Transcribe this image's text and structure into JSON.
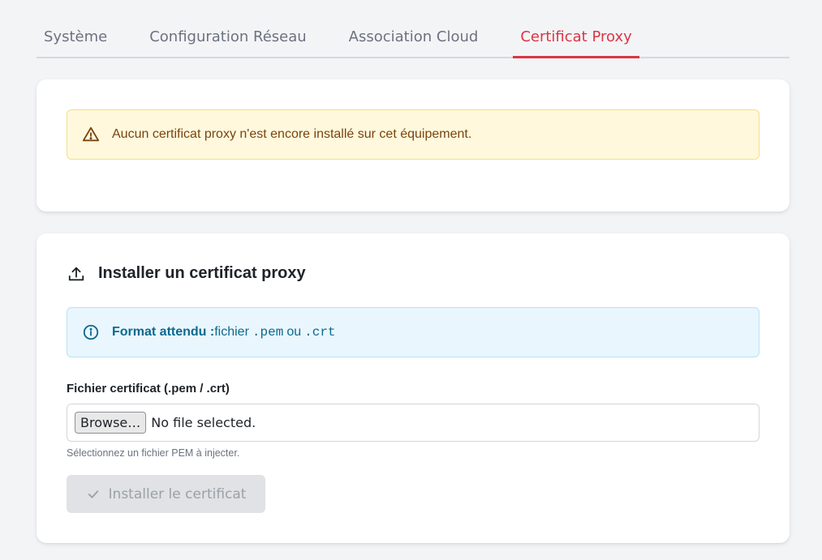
{
  "tabs": [
    {
      "label": "Système",
      "active": false
    },
    {
      "label": "Configuration Réseau",
      "active": false
    },
    {
      "label": "Association Cloud",
      "active": false
    },
    {
      "label": "Certificat Proxy",
      "active": true
    }
  ],
  "status_card": {
    "warning_icon": "warning-triangle-icon",
    "warning_text": "Aucun certificat proxy n'est encore installé sur cet équipement."
  },
  "install_card": {
    "title_icon": "upload-icon",
    "title": "Installer un certificat proxy",
    "info_icon": "info-circle-icon",
    "info_strong": "Format attendu :",
    "info_text_1": "fichier",
    "info_code_1": ".pem",
    "info_text_2": "ou",
    "info_code_2": ".crt",
    "field_label": "Fichier certificat (.pem / .crt)",
    "browse_label": "Browse…",
    "file_status": "No file selected.",
    "help_text": "Sélectionnez un fichier PEM à injecter.",
    "submit_icon": "check-icon",
    "submit_label": "Installer le certificat",
    "submit_disabled": true
  },
  "colors": {
    "accent": "#dc3545",
    "warning_bg": "#fff8dc",
    "warning_text": "#7a4410",
    "info_bg": "#e9f6fd",
    "info_text": "#0b6a8f"
  }
}
